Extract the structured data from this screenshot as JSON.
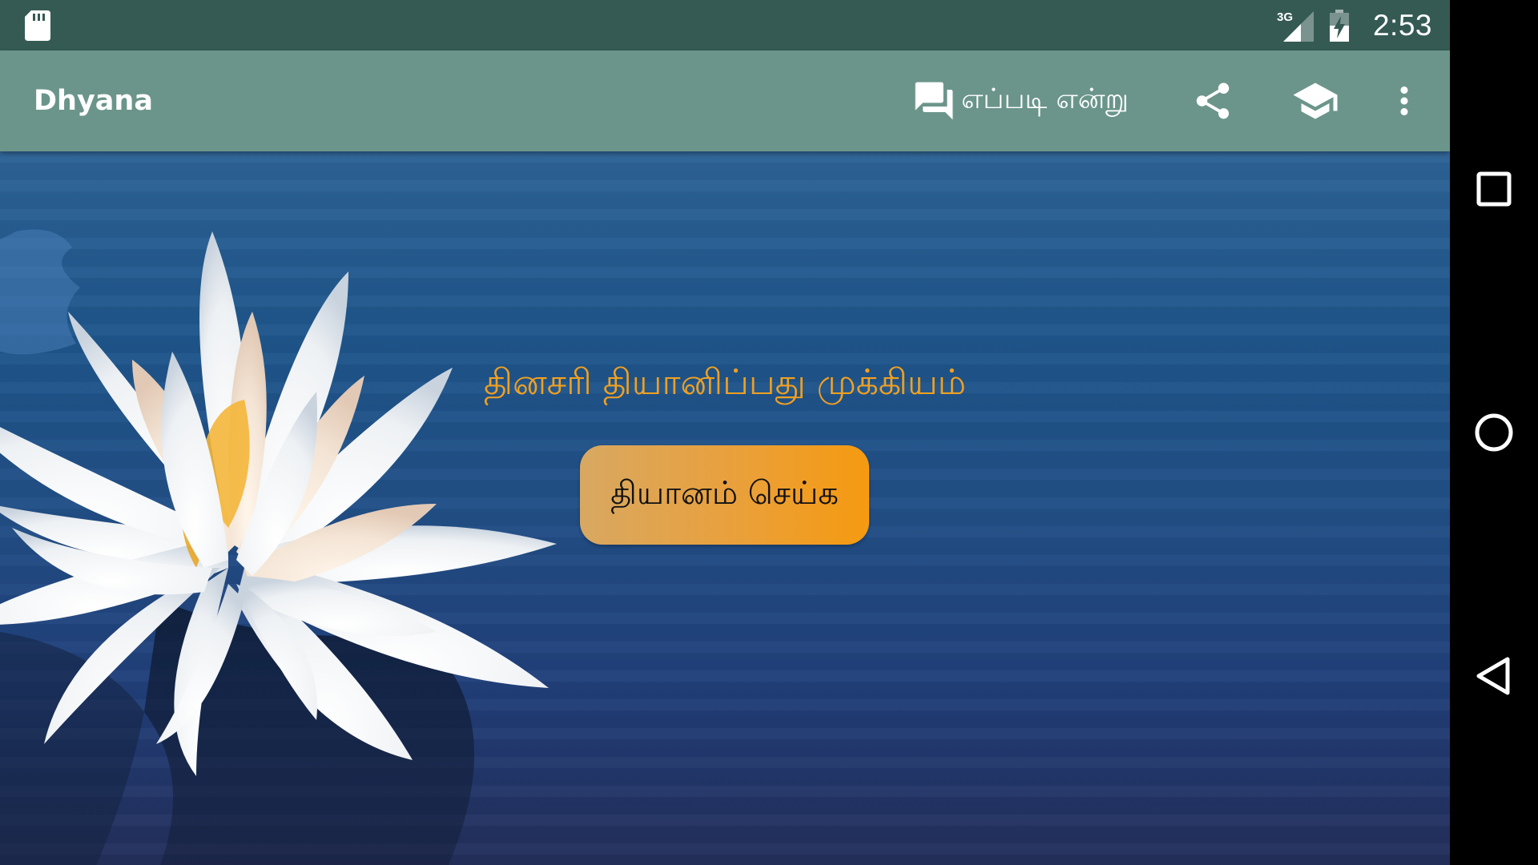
{
  "status_bar": {
    "network_label": "3G",
    "time": "2:53",
    "icons": [
      "sd-card-icon",
      "signal-icon",
      "battery-charging-icon"
    ]
  },
  "app_bar": {
    "title": "Dhyana",
    "how_to_label": "எப்படி என்று",
    "icons": [
      "forum-icon",
      "share-icon",
      "school-icon",
      "more-vert-icon"
    ]
  },
  "main": {
    "tagline": "தினசரி தியானிப்பது முக்கியம்",
    "meditate_button": "தியானம் செய்க"
  },
  "nav_bar": {
    "icons": [
      "recents-icon",
      "home-icon",
      "back-icon"
    ]
  },
  "colors": {
    "status_bar": "#355a54",
    "app_bar": "#6b958b",
    "tagline": "#f0a020",
    "button": "#f59a10"
  }
}
